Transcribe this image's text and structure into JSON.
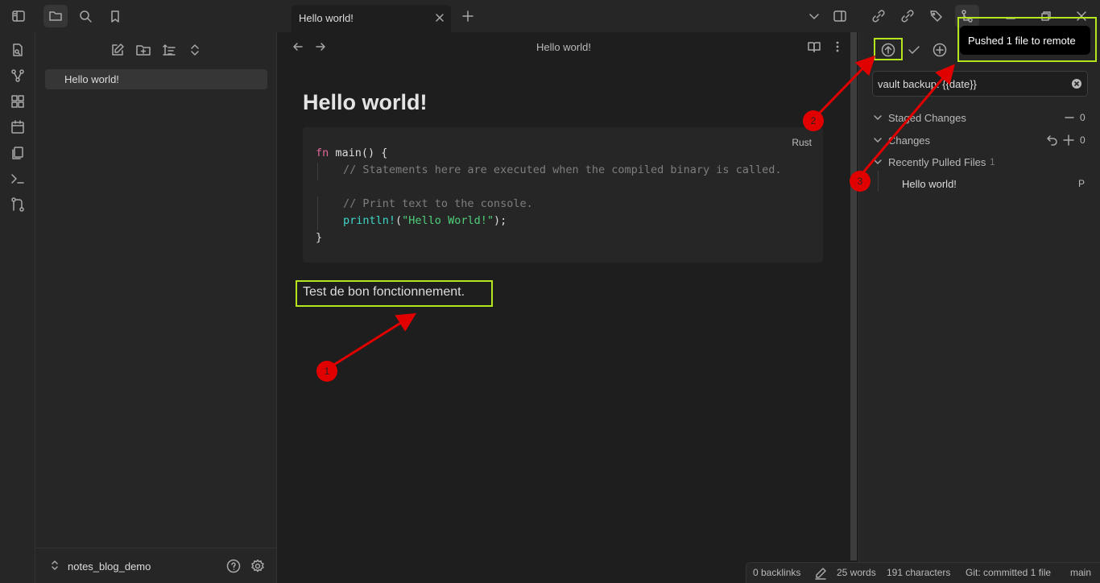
{
  "tab": {
    "title": "Hello world!"
  },
  "sidebar": {
    "files": [
      {
        "name": "Hello world!"
      }
    ],
    "vault_name": "notes_blog_demo"
  },
  "editor": {
    "header_title": "Hello world!",
    "heading": "Hello world!",
    "code": {
      "language": "Rust",
      "line1_kw": "fn",
      "line1_rest": " main() {",
      "line2": "// Statements here are executed when the compiled binary is called.",
      "line4": "// Print text to the console.",
      "line5_fn": "println!",
      "line5_open": "(",
      "line5_str": "\"Hello World!\"",
      "line5_close": ");",
      "line6": "}"
    },
    "paragraph": "Test de bon fonctionnement."
  },
  "git_panel": {
    "commit_message": "vault backup: {{date}}",
    "staged_label": "Staged Changes",
    "staged_count": "0",
    "changes_label": "Changes",
    "changes_count": "0",
    "recent_label": "Recently Pulled Files",
    "recent_count": "1",
    "recent_files": [
      {
        "name": "Hello world!",
        "status": "P"
      }
    ]
  },
  "notice": {
    "text": "Pushed 1 file to remote"
  },
  "status_bar": {
    "backlinks": "0 backlinks",
    "words": "25 words",
    "characters": "191 characters",
    "git_status": "Git: committed 1 file",
    "branch": "main"
  },
  "annotations": {
    "badge1": "1",
    "badge2": "2",
    "badge3": "3",
    "highlight_color": "#b5e61d",
    "arrow_color": "#e00000"
  }
}
